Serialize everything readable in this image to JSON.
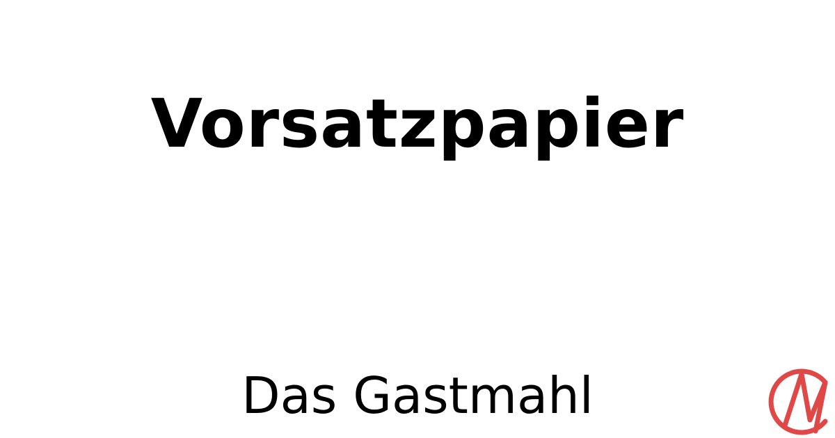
{
  "card": {
    "title": "Vorsatzpapier",
    "subtitle": "Das Gastmahl"
  },
  "logo": {
    "icon": "publisher-logo-icon",
    "color": "#e04848"
  },
  "colors": {
    "background": "#ffffff",
    "text": "#000000"
  }
}
